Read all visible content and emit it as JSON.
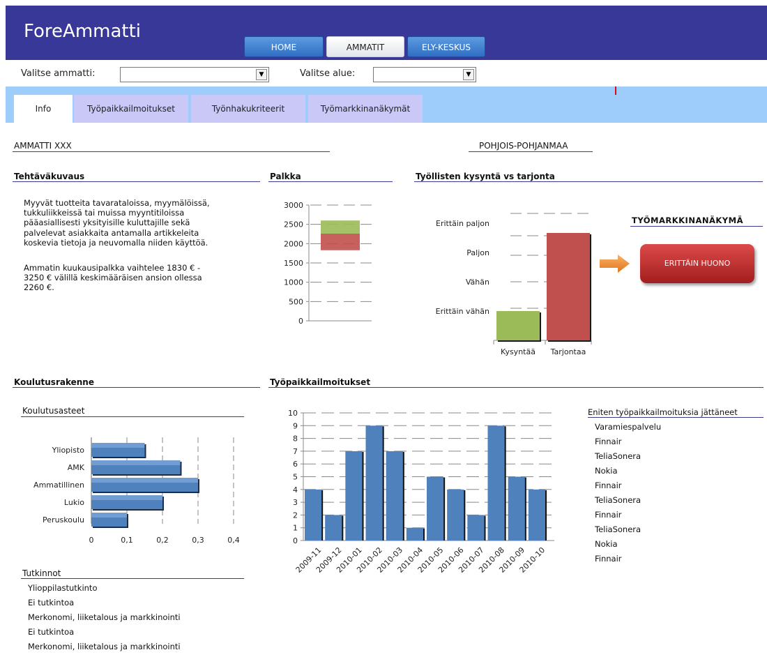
{
  "app": {
    "title": "ForeAmmatti"
  },
  "nav": {
    "home": "HOME",
    "ammatit": "AMMATIT",
    "ely": "ELY-KESKUS"
  },
  "filters": {
    "ammatti_label": "Valitse ammatti:",
    "ammatti_value": "",
    "alue_label": "Valitse alue:",
    "alue_value": ""
  },
  "tabs": {
    "info": "Info",
    "tyopaikkailmoitukset": "Työpaikkailmoitukset",
    "tyonhakukriteerit": "Työnhakukriteerit",
    "tyomarkkinanakymat": "Työmarkkinanäkymät"
  },
  "occupation": {
    "name": "AMMATTI XXX",
    "region": "POHJOIS-POHJANMAA"
  },
  "tehtavakuvaus": {
    "heading": "Tehtäväkuvaus",
    "lines1": [
      "Myyvät tuotteita tavarataloissa, myymälöissä,",
      "tukkuliikkeissä tai muissa myyntitiloissa",
      "pääasiallisesti yksityisille kuluttajille sekä",
      "palvelevat asiakkaita antamalla artikkeleita",
      "koskevia tietoja ja neuvomalla niiden käyttöä."
    ],
    "lines2": [
      "Ammatin kuukausipalkka vaihtelee 1830 € -",
      "3250 € välillä keskimääräisen ansion ollessa",
      "2260 €."
    ]
  },
  "palkka": {
    "heading": "Palkka"
  },
  "kysynta": {
    "heading": "Työllisten kysyntä vs tarjonta"
  },
  "tyomarkkina": {
    "heading": "TYÖMARKKINANÄKYMÄ",
    "status": "ERITTÄIN HUONO",
    "status_color": "#b72c2c"
  },
  "koulutus": {
    "heading": "Koulutusrakenne",
    "chart_title": "Koulutusasteet"
  },
  "tyopaikat": {
    "heading": "Työpaikkailmoitukset"
  },
  "employers": {
    "heading": "Eniten työpaikkailmoituksia jättäneet",
    "items": [
      "Varamiespalvelu",
      "Finnair",
      "TeliaSonera",
      "Nokia",
      "Finnair",
      "TeliaSonera",
      "Finnair",
      "TeliaSonera",
      "Nokia",
      "Finnair"
    ]
  },
  "tutkinnot": {
    "heading": "Tutkinnot",
    "items": [
      "Ylioppilastutkinto",
      "Ei tutkintoa",
      "Merkonomi, liiketalous ja markkinointi",
      "Ei tutkintoa",
      "Merkonomi, liiketalous ja markkinointi"
    ]
  },
  "chart_data": [
    {
      "type": "bar",
      "title": "Palkka",
      "ylim": [
        0,
        3000
      ],
      "yticks": [
        0,
        500,
        1000,
        1500,
        2000,
        2500,
        3000
      ],
      "series": [
        {
          "name": "",
          "range": [
            1830,
            2260
          ],
          "color": "#c0504d"
        },
        {
          "name": "",
          "range": [
            2260,
            2600
          ],
          "color": "#9bbb59"
        }
      ],
      "grid": true
    },
    {
      "type": "bar",
      "title": "Työllisten kysyntä vs tarjonta",
      "categories": [
        "Kysyntää",
        "Tarjontaa"
      ],
      "values": [
        1,
        4
      ],
      "colors": [
        "#9bbb59",
        "#c0504d"
      ],
      "ytick_labels": [
        "Erittäin vähän",
        "Vähän",
        "Paljon",
        "Erittäin paljon"
      ],
      "grid": true
    },
    {
      "type": "bar",
      "orientation": "horizontal",
      "title": "Koulutusasteet",
      "categories": [
        "Yliopisto",
        "AMK",
        "Ammatillinen",
        "Lukio",
        "Peruskoulu"
      ],
      "values": [
        0.15,
        0.25,
        0.3,
        0.2,
        0.1
      ],
      "xlim": [
        0,
        0.4
      ],
      "xticks": [
        "0",
        "0,1",
        "0,2",
        "0,3",
        "0,4"
      ],
      "color": "#4f81bd",
      "grid": true
    },
    {
      "type": "bar",
      "title": "Työpaikkailmoitukset",
      "categories": [
        "2009-11",
        "2009-12",
        "2010-01",
        "2010-02",
        "2010-03",
        "2010-04",
        "2010-05",
        "2010-06",
        "2010-07",
        "2010-08",
        "2010-09",
        "2010-10"
      ],
      "values": [
        4,
        2,
        7,
        9,
        7,
        1,
        5,
        4,
        2,
        9,
        5,
        4
      ],
      "ylim": [
        0,
        10
      ],
      "yticks": [
        0,
        1,
        2,
        3,
        4,
        5,
        6,
        7,
        8,
        9,
        10
      ],
      "color": "#4f81bd",
      "grid": true
    }
  ]
}
